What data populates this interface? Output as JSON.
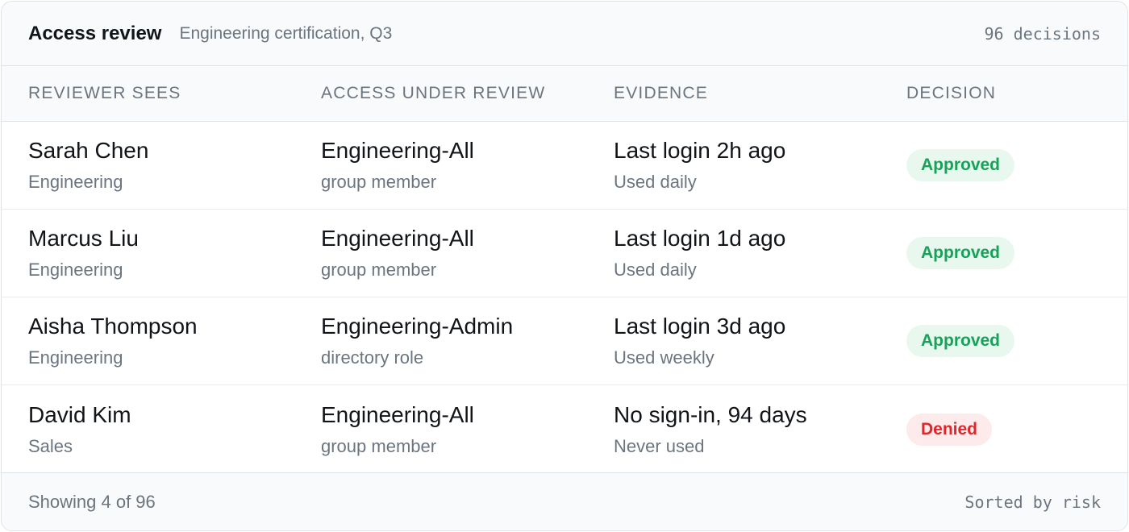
{
  "header": {
    "title": "Access review",
    "subtitle": "Engineering certification, Q3",
    "count": "96 decisions"
  },
  "columns": [
    "REVIEWER SEES",
    "ACCESS UNDER REVIEW",
    "EVIDENCE",
    "DECISION"
  ],
  "rows": [
    {
      "name": "Sarah Chen",
      "dept": "Engineering",
      "access": "Engineering-All",
      "access_type": "group member",
      "evidence": "Last login 2h ago",
      "usage": "Used daily",
      "decision": "Approved"
    },
    {
      "name": "Marcus Liu",
      "dept": "Engineering",
      "access": "Engineering-All",
      "access_type": "group member",
      "evidence": "Last login 1d ago",
      "usage": "Used daily",
      "decision": "Approved"
    },
    {
      "name": "Aisha Thompson",
      "dept": "Engineering",
      "access": "Engineering-Admin",
      "access_type": "directory role",
      "evidence": "Last login 3d ago",
      "usage": "Used weekly",
      "decision": "Approved"
    },
    {
      "name": "David Kim",
      "dept": "Sales",
      "access": "Engineering-All",
      "access_type": "group member",
      "evidence": "No sign-in, 94 days",
      "usage": "Never used",
      "decision": "Denied"
    }
  ],
  "footer": {
    "showing": "Showing 4 of 96",
    "sorted": "Sorted by risk"
  },
  "colors": {
    "approved_text": "#18a159",
    "approved_bg": "#e8f8ef",
    "denied_text": "#e0262a",
    "denied_bg": "#fdeaea"
  }
}
